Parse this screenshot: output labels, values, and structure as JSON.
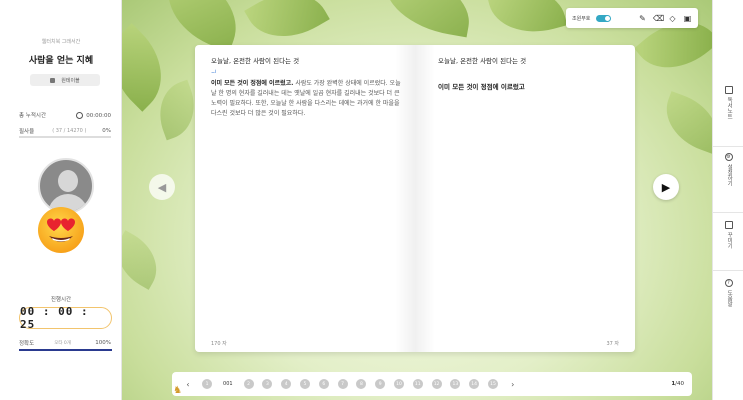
{
  "left": {
    "brand_sub": "웹터치북 그래서간",
    "book_title": "사람을 얻는 지혜",
    "mode_label": "원테이블",
    "read_time_label": "총 누적시간",
    "read_time_value": "00:00:00",
    "read_count_label": "필사율",
    "read_count_mid": "( 37 / 14270 )",
    "read_count_pct": "0%",
    "timer_label": "진행시간",
    "timer_value": "00 : 00 : 25",
    "accuracy_label": "정확도",
    "accuracy_mid": "오타 0개",
    "accuracy_pct": "100%"
  },
  "toolbar": {
    "compare_label": "조원부호",
    "icons": [
      "highlighter-icon",
      "eraser-icon",
      "clear-icon",
      "save-icon"
    ]
  },
  "book": {
    "left_title": "오늘날, 온전한 사람이 된다는 것",
    "left_cursor": "ᅬ",
    "left_body_bold": "이미 모든 것이 정점에 이르렀고.",
    "left_body_rest": " 사람도 가장 완벽한 상태에 이르렀다. 오늘날 한 명의 현자를 길러내는 데는 옛날에 일곱 현자를 길러내는 것보다 더 큰 노력이 필요하다. 또한, 오늘날 한 사람을 다스리는 데에는 과거에 한 마을을 다스린 것보다 더 많은 것이 필요하다.",
    "left_count": "170 자",
    "right_title": "오늘날, 온전한 사람이 된다는 것",
    "right_line": "이미 모든 것이 정점에 이르렀고",
    "right_count": "37 자"
  },
  "pager": {
    "pages": [
      "1",
      "001",
      "2",
      "3",
      "4",
      "5",
      "6",
      "7",
      "8",
      "9",
      "10",
      "11",
      "12",
      "13",
      "14",
      "15"
    ],
    "current": "1",
    "total": "40"
  },
  "rail": {
    "notes": "독서노트",
    "settings": "설정하기",
    "decorate": "꾸미기",
    "help": "도움말"
  },
  "colors": {
    "accent": "#34a8c4",
    "timer_border": "#f2c46d",
    "progress": "#2a3a8f"
  }
}
